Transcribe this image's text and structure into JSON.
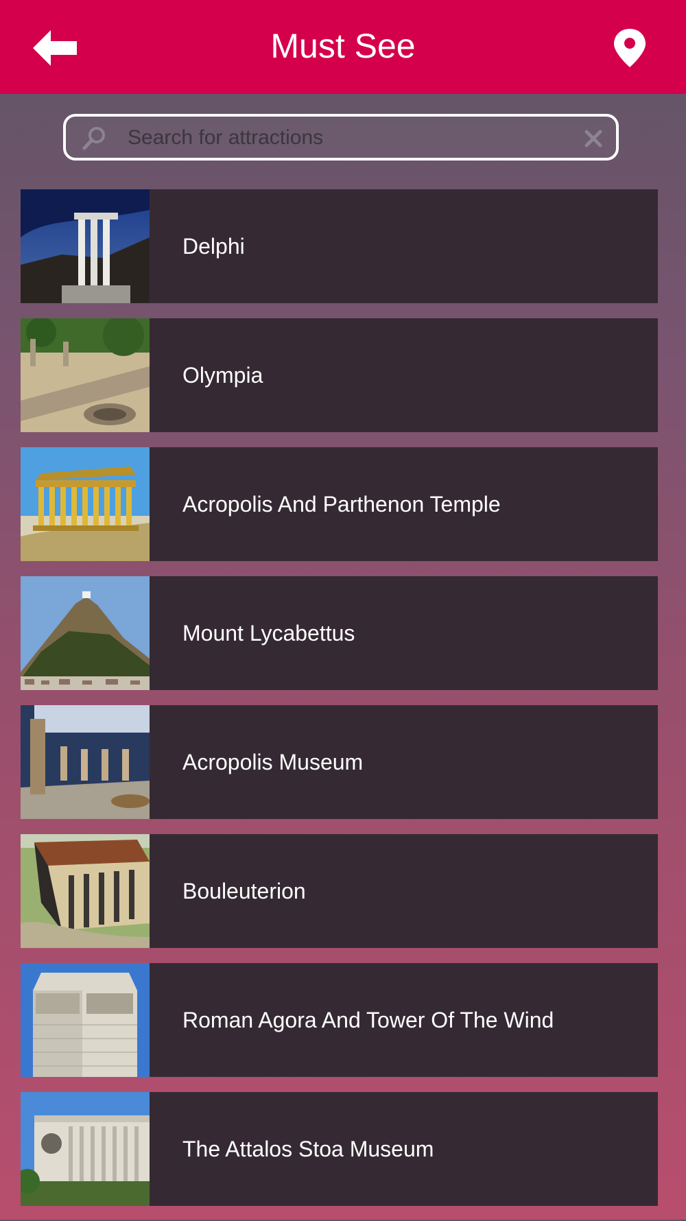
{
  "header": {
    "title": "Must See",
    "back_icon": "arrow-left-icon",
    "location_icon": "map-pin-icon",
    "bg_color": "#d4004b"
  },
  "search": {
    "placeholder": "Search for attractions",
    "value": "",
    "search_icon": "magnifier-icon",
    "clear_icon": "close-icon"
  },
  "attractions": [
    {
      "name": "Delphi"
    },
    {
      "name": "Olympia"
    },
    {
      "name": "Acropolis And Parthenon Temple"
    },
    {
      "name": "Mount Lycabettus"
    },
    {
      "name": "Acropolis Museum"
    },
    {
      "name": "Bouleuterion"
    },
    {
      "name": "Roman Agora And Tower Of The Wind"
    },
    {
      "name": "The Attalos Stoa Museum"
    }
  ]
}
